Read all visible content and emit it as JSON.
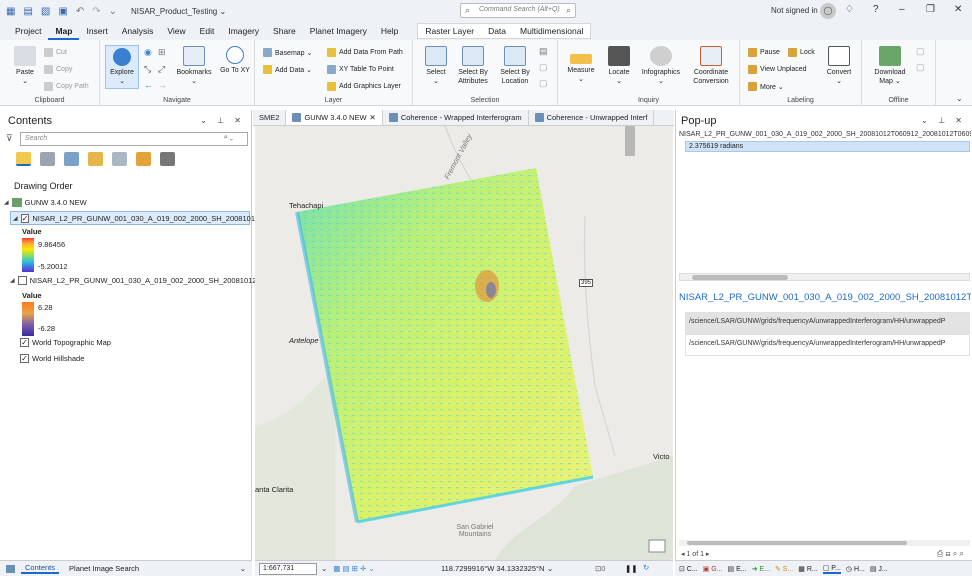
{
  "app": {
    "project_title": "NISAR_Product_Testing ⌄",
    "command_search_placeholder": "Command Search (Alt+Q)",
    "signed_in": "Not signed in"
  },
  "menu": {
    "items": [
      "Project",
      "Map",
      "Insert",
      "Analysis",
      "View",
      "Edit",
      "Imagery",
      "Share",
      "Planet Imagery",
      "Help"
    ],
    "active": "Map",
    "context": [
      "Raster Layer",
      "Data",
      "Multidimensional"
    ]
  },
  "ribbon": {
    "clipboard": {
      "label": "Clipboard",
      "paste": "Paste",
      "cut": "Cut",
      "copy": "Copy",
      "copy_path": "Copy Path"
    },
    "navigate": {
      "label": "Navigate",
      "explore": "Explore",
      "bookmarks": "Bookmarks",
      "goto": "Go To XY"
    },
    "layer": {
      "label": "Layer",
      "basemap": "Basemap ⌄",
      "add_data": "Add Data ⌄",
      "add_data_from_path": "Add Data From Path",
      "xy_table": "XY Table To Point",
      "add_graphics": "Add Graphics Layer"
    },
    "selection": {
      "label": "Selection",
      "select": "Select",
      "select_by_attr": "Select By Attributes",
      "select_by_loc": "Select By Location"
    },
    "inquiry": {
      "label": "Inquiry",
      "measure": "Measure",
      "locate": "Locate",
      "infographics": "Infographics",
      "coord_conv": "Coordinate Conversion"
    },
    "labeling": {
      "label": "Labeling",
      "pause": "Pause",
      "lock": "Lock",
      "view_unplaced": "View Unplaced",
      "more": "More ⌄",
      "convert": "Convert"
    },
    "offline": {
      "label": "Offline",
      "download_map": "Download Map ⌄"
    }
  },
  "contents": {
    "title": "Contents",
    "search_placeholder": "Search",
    "drawing_order": "Drawing Order",
    "map_name": "GUNW 3.4.0 NEW",
    "layer1": {
      "name": "NISAR_L2_PR_GUNW_001_030_A_019_002_2000_SH_20081012T...",
      "value_label": "Value",
      "max": "9.86456",
      "min": "-5.20012"
    },
    "layer2": {
      "name": "NISAR_L2_PR_GUNW_001_030_A_019_002_2000_SH_20081012T...",
      "value_label": "Value",
      "max": "6.28",
      "min": "-6.28"
    },
    "layer3": "World Topographic Map",
    "layer4": "World Hillshade",
    "bottom_tabs": [
      "Contents",
      "Planet Image Search"
    ]
  },
  "map_tabs": [
    "SME2",
    "GUNW 3.4.0 NEW",
    "Coherence - Wrapped Interferogram",
    "Coherence - Unwrapped Interf"
  ],
  "map": {
    "labels": {
      "tehachapi": "Tehachapi",
      "fremont": "Fremont Valley",
      "antelope": "Antelope",
      "santa_clarita": "anta Clarita",
      "victorville": "Victo",
      "gabriel": "San Gabriel Mountains",
      "hwy395": "395"
    },
    "scale": "1:667,731",
    "coordinate": "118.7299916°W 34.1332325°N"
  },
  "popup": {
    "title": "Pop-up",
    "layer_line": "NISAR_L2_PR_GUNW_001_030_A_019_002_2000_SH_20081012T060912_20081012T0609",
    "value": "2.375619 radians",
    "header": "NISAR_L2_PR_GUNW_001_030_A_019_002_2000_SH_20081012T060912...",
    "rows": [
      "/science/LSAR/GUNW/grids/frequencyA/unwrappedInterferogram/HH/unwrappedP",
      "/science/LSAR/GUNW/grids/frequencyA/unwrappedInterferogram/HH/unwrappedP"
    ],
    "page": "1 of 1"
  },
  "colors": {
    "accent": "#1b6ac9",
    "ramp_low": "#3b2aa0",
    "ramp_high": "#ffe600"
  }
}
